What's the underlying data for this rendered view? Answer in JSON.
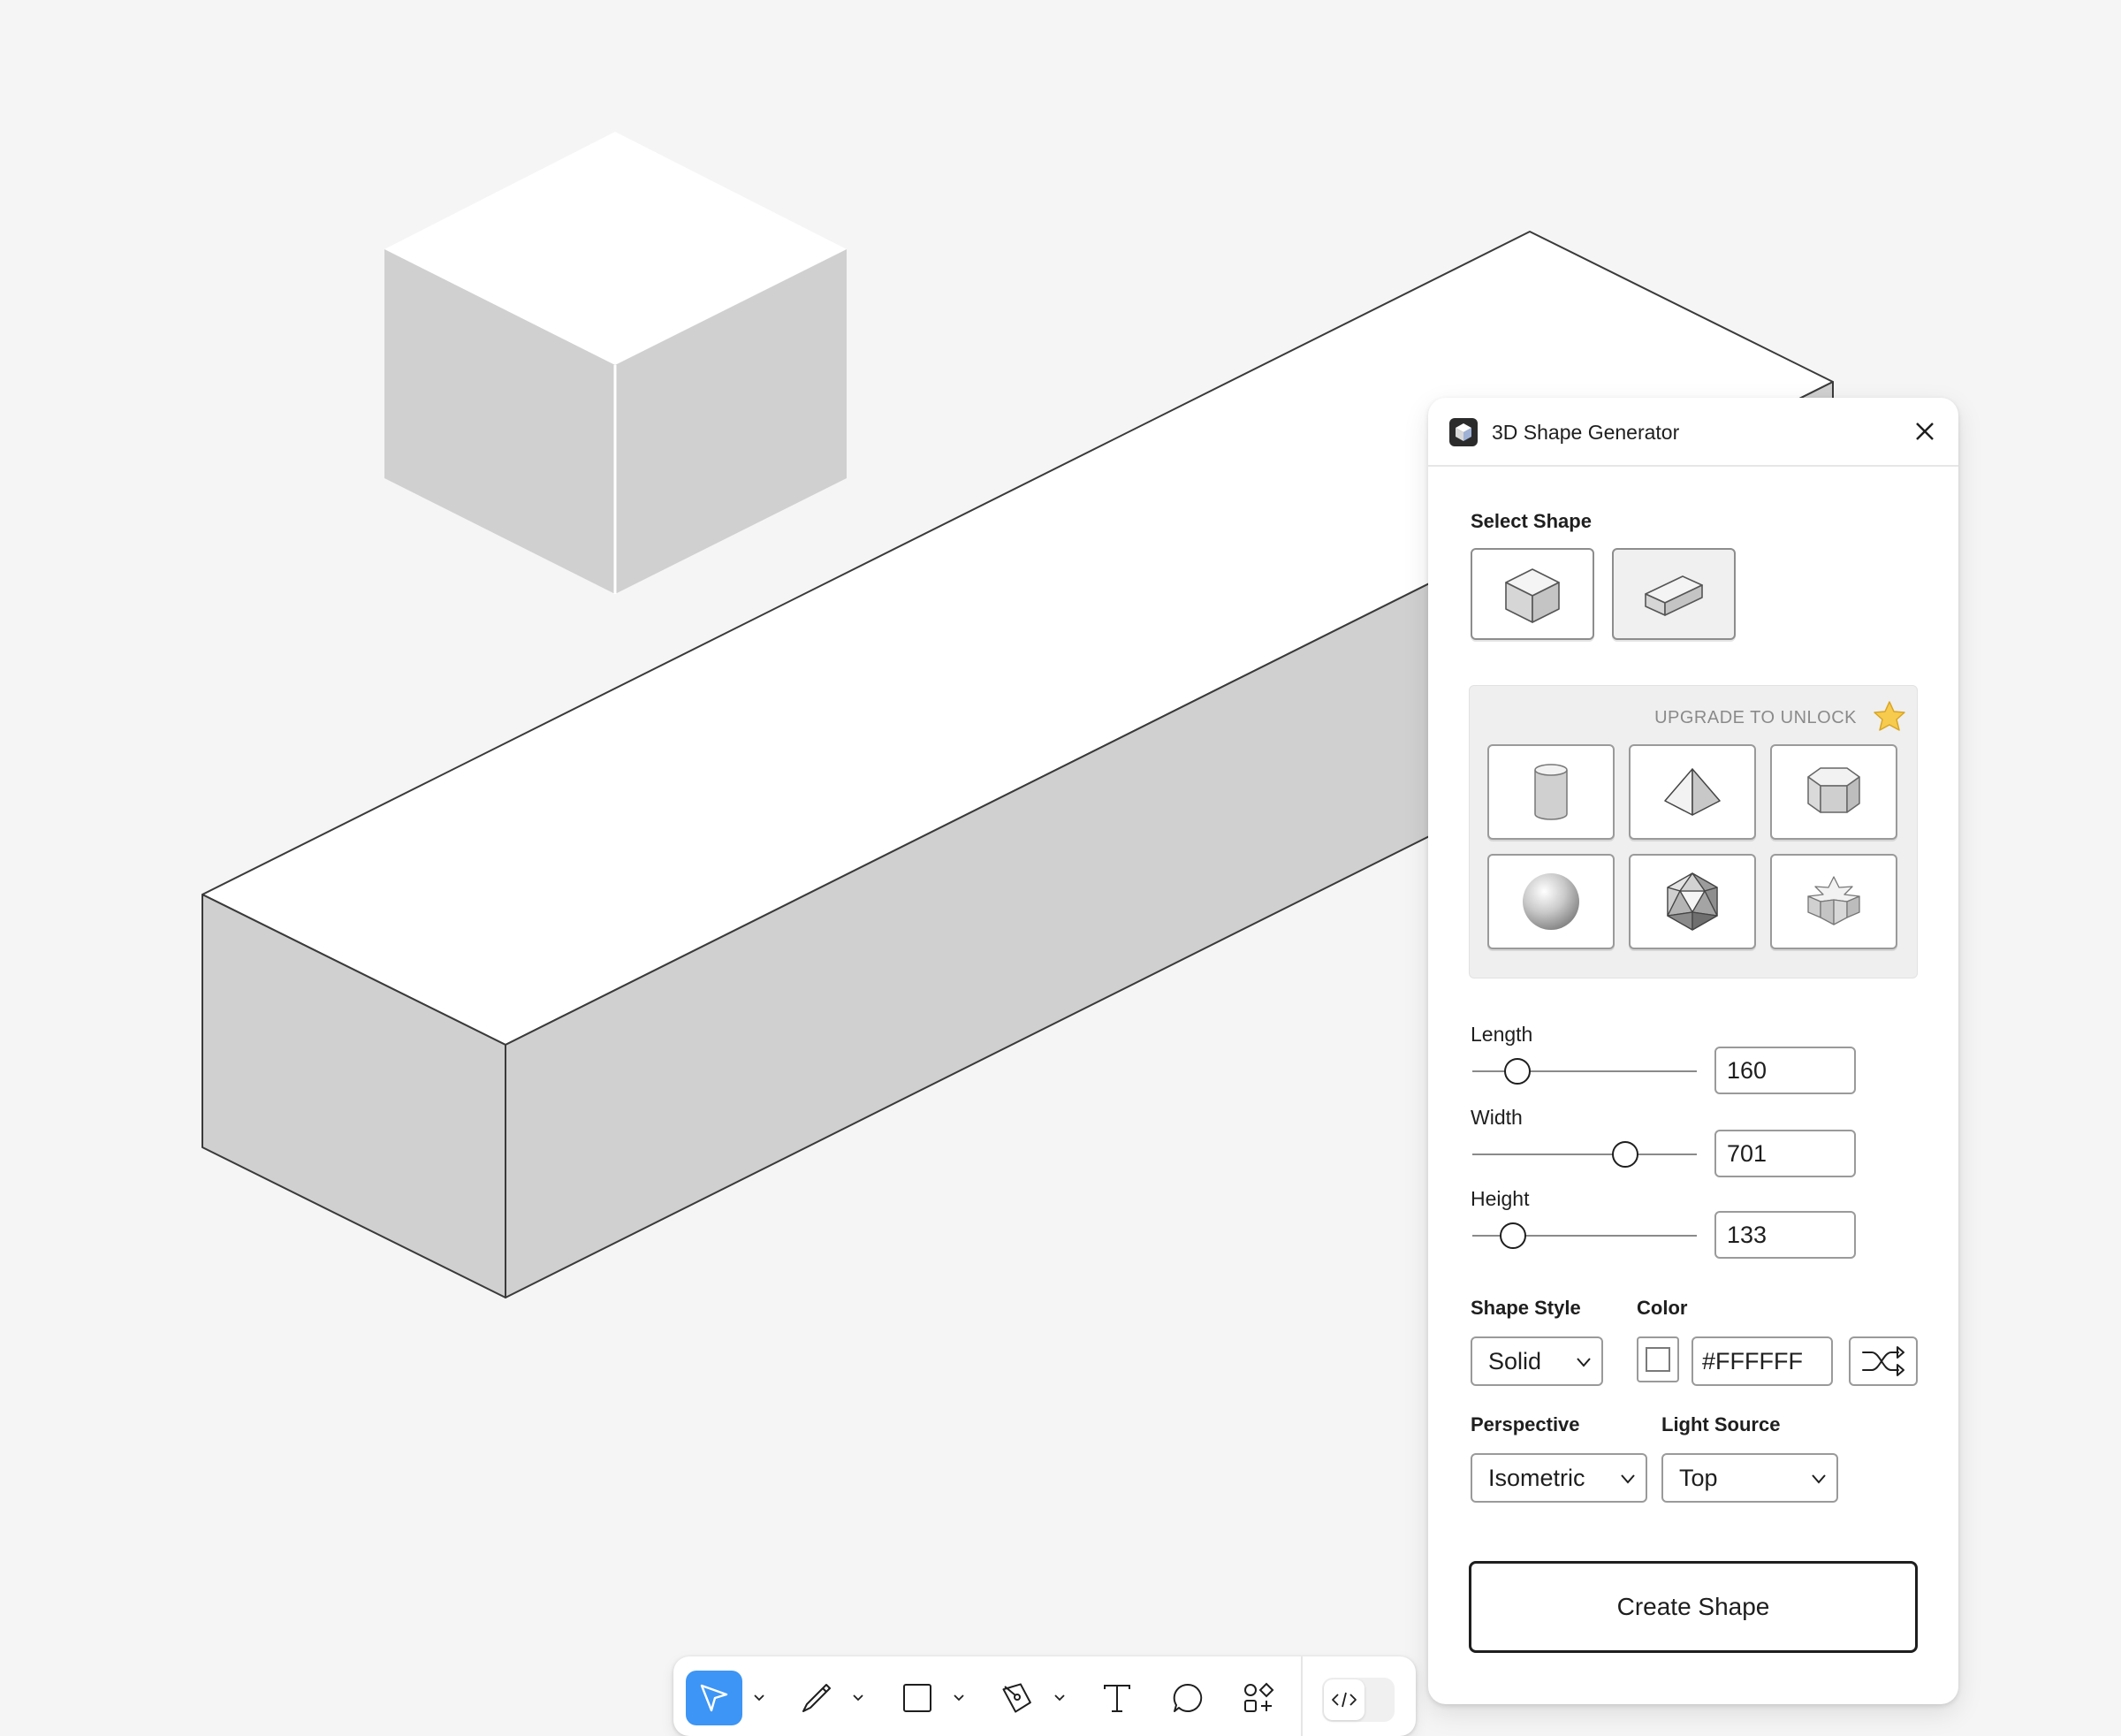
{
  "canvas": {
    "objects": [
      "small-cube",
      "long-box"
    ]
  },
  "plugin": {
    "title": "3D Shape Generator",
    "select_shape_label": "Select Shape",
    "free_shapes": [
      "cube",
      "rectangular-prism"
    ],
    "selected_shape": "rectangular-prism",
    "upgrade_label": "UPGRADE TO UNLOCK",
    "locked_shapes": [
      "cylinder",
      "pyramid",
      "hexagonal-prism",
      "sphere",
      "icosahedron",
      "star-prism"
    ],
    "dimensions": {
      "length": {
        "label": "Length",
        "value": "160",
        "fraction": 0.2
      },
      "width": {
        "label": "Width",
        "value": "701",
        "fraction": 0.68
      },
      "height": {
        "label": "Height",
        "value": "133",
        "fraction": 0.18
      }
    },
    "shape_style": {
      "label": "Shape Style",
      "value": "Solid"
    },
    "color": {
      "label": "Color",
      "value": "#FFFFFF"
    },
    "perspective": {
      "label": "Perspective",
      "value": "Isometric"
    },
    "light_source": {
      "label": "Light Source",
      "value": "Top"
    },
    "create_label": "Create Shape"
  },
  "toolbar": {
    "tools": [
      "move-tool",
      "pencil-tool",
      "rectangle-tool",
      "pen-tool",
      "text-tool",
      "comment-tool",
      "actions-tool"
    ],
    "active_tool": "move-tool",
    "accent_color": "#3d95f5"
  }
}
